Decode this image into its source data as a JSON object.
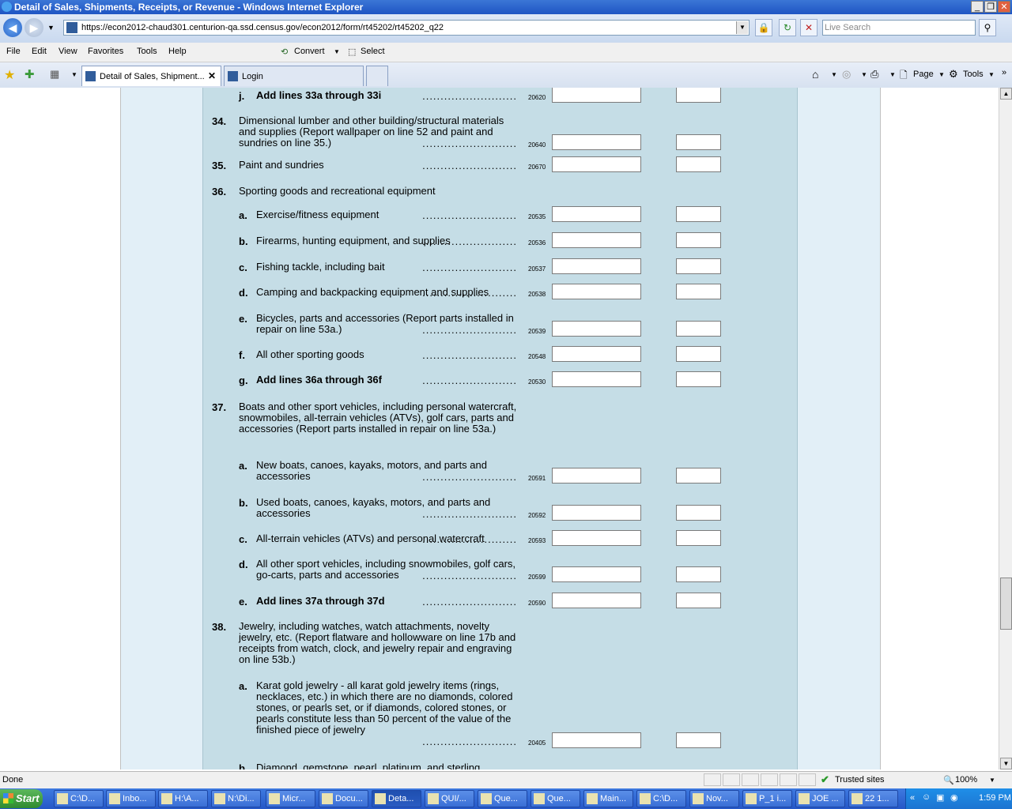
{
  "window": {
    "title": "Detail of Sales, Shipments, Receipts, or Revenue - Windows Internet Explorer"
  },
  "address_bar": {
    "url": "https://econ2012-chaud301.centurion-qa.ssd.census.gov/econ2012/form/rt45202/rt45202_q22"
  },
  "search": {
    "placeholder": "Live Search"
  },
  "toolbar": {
    "convert": "Convert",
    "select": "Select"
  },
  "menu": [
    "File",
    "Edit",
    "View",
    "Favorites",
    "Tools",
    "Help"
  ],
  "tabs": [
    {
      "label": "Detail of Sales, Shipment..."
    },
    {
      "label": "Login"
    }
  ],
  "command_bar": {
    "page": "Page",
    "tools": "Tools"
  },
  "form": {
    "rows": [
      {
        "num": "",
        "letter": "j.",
        "desc": "Add lines 33a through 33i",
        "bold": true,
        "code": "20620"
      },
      {
        "num": "34.",
        "letter": "",
        "desc": "Dimensional lumber and other building/structural materials and supplies (Report wallpaper on line 52 and paint and sundries on line 35.)",
        "bold": false,
        "code": "20640"
      },
      {
        "num": "35.",
        "letter": "",
        "desc": "Paint and sundries",
        "bold": false,
        "code": "20670"
      },
      {
        "num": "36.",
        "letter": "",
        "desc": "Sporting goods and recreational equipment",
        "bold": false,
        "code": ""
      },
      {
        "num": "",
        "letter": "a.",
        "desc": "Exercise/fitness equipment",
        "bold": false,
        "code": "20535"
      },
      {
        "num": "",
        "letter": "b.",
        "desc": "Firearms, hunting equipment, and supplies",
        "bold": false,
        "code": "20536"
      },
      {
        "num": "",
        "letter": "c.",
        "desc": "Fishing tackle, including bait",
        "bold": false,
        "code": "20537"
      },
      {
        "num": "",
        "letter": "d.",
        "desc": "Camping and backpacking equipment and supplies",
        "bold": false,
        "code": "20538"
      },
      {
        "num": "",
        "letter": "e.",
        "desc": "Bicycles, parts and accessories (Report parts installed in repair on line 53a.)",
        "bold": false,
        "code": "20539"
      },
      {
        "num": "",
        "letter": "f.",
        "desc": "All other sporting goods",
        "bold": false,
        "code": "20548"
      },
      {
        "num": "",
        "letter": "g.",
        "desc": "Add lines 36a through 36f",
        "bold": true,
        "code": "20530"
      },
      {
        "num": "37.",
        "letter": "",
        "desc": "Boats and other sport vehicles, including personal watercraft, snowmobiles, all-terrain vehicles (ATVs), golf cars, parts and accessories (Report parts installed in repair on line 53a.)",
        "bold": false,
        "code": ""
      },
      {
        "num": "",
        "letter": "a.",
        "desc": "New boats, canoes, kayaks, motors, and parts and accessories",
        "bold": false,
        "code": "20591"
      },
      {
        "num": "",
        "letter": "b.",
        "desc": "Used boats, canoes, kayaks, motors, and parts and accessories",
        "bold": false,
        "code": "20592"
      },
      {
        "num": "",
        "letter": "c.",
        "desc": "All-terrain vehicles (ATVs) and personal watercraft",
        "bold": false,
        "code": "20593"
      },
      {
        "num": "",
        "letter": "d.",
        "desc": "All other sport vehicles, including snowmobiles, golf cars, go-carts, parts and accessories",
        "bold": false,
        "code": "20599"
      },
      {
        "num": "",
        "letter": "e.",
        "desc": "Add lines 37a through 37d",
        "bold": true,
        "code": "20590"
      },
      {
        "num": "38.",
        "letter": "",
        "desc": "Jewelry, including watches, watch attachments, novelty jewelry, etc. (Report flatware and hollowware on line 17b and receipts from watch, clock, and jewelry repair and engraving on line 53b.)",
        "bold": false,
        "code": ""
      },
      {
        "num": "",
        "letter": "a.",
        "desc": "Karat gold jewelry - all karat gold jewelry items (rings, necklaces, etc.) in which there are no diamonds, colored stones, or pearls set, or if diamonds, colored stones, or pearls constitute less than 50 percent of the value of the finished piece of jewelry",
        "bold": false,
        "code": "20405"
      },
      {
        "num": "",
        "letter": "b.",
        "desc": "Diamond, gemstone, pearl, platinum, and sterling",
        "bold": false,
        "code": ""
      }
    ]
  },
  "status": {
    "left": "Done",
    "zone": "Trusted sites",
    "zoom": "100%"
  },
  "taskbar": {
    "start": "Start",
    "items": [
      "C:\\D...",
      "Inbo...",
      "H:\\A...",
      "N:\\Di...",
      "Micr...",
      "Docu...",
      "Deta...",
      "QUI/...",
      "Que...",
      "Que...",
      "Main...",
      "C:\\D...",
      "Nov...",
      "P_1 i...",
      "JOE ...",
      "22 1..."
    ],
    "time": "1:59 PM"
  }
}
